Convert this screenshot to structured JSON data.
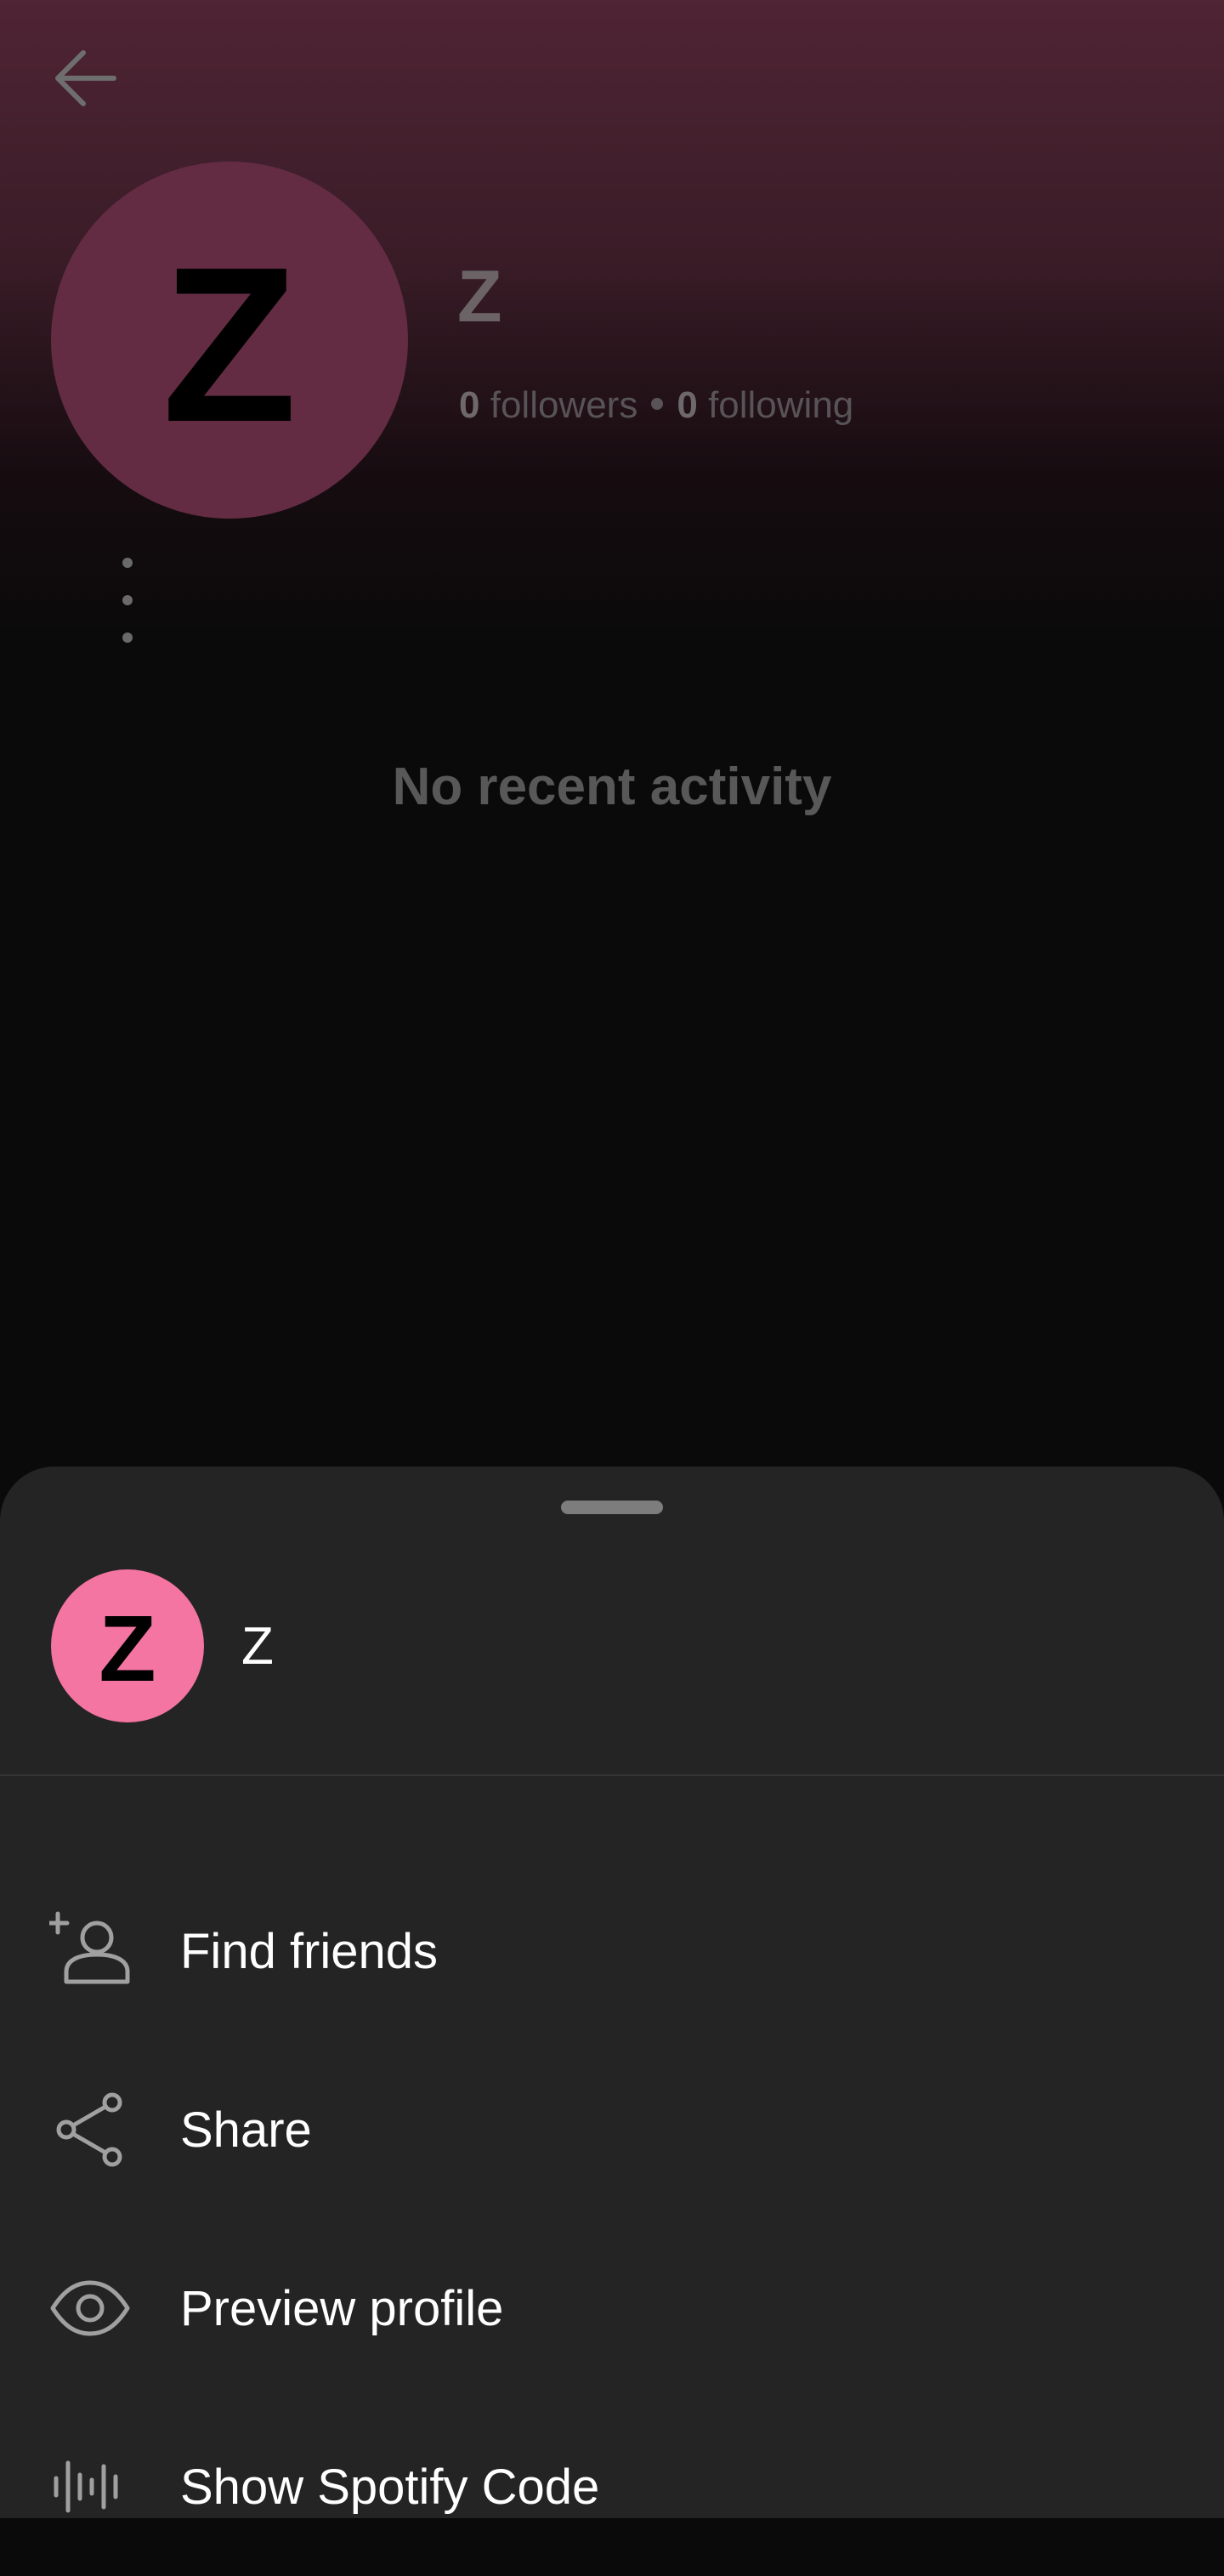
{
  "profile": {
    "back_icon": "arrow-left-icon",
    "avatar_initial": "Z",
    "name": "Z",
    "followers_count": "0",
    "followers_label": "followers",
    "following_count": "0",
    "following_label": "following",
    "more_icon": "more-vertical-icon",
    "empty_message": "No recent activity",
    "avatar_color": "#632c42"
  },
  "sheet": {
    "avatar_initial": "Z",
    "name": "Z",
    "avatar_color": "#f475a1",
    "items": [
      {
        "label": "Find friends",
        "icon": "add-person-icon"
      },
      {
        "label": "Share",
        "icon": "share-icon"
      },
      {
        "label": "Preview profile",
        "icon": "eye-icon"
      },
      {
        "label": "Show Spotify Code",
        "icon": "spotify-code-icon"
      }
    ]
  }
}
